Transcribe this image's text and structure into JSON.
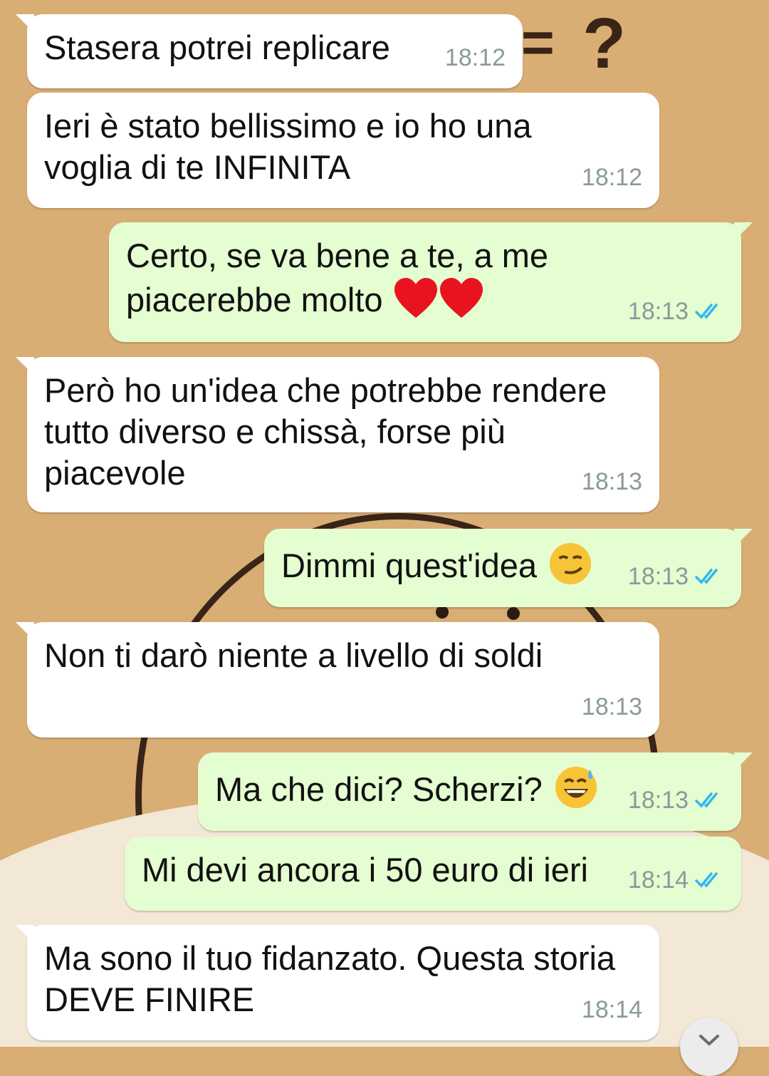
{
  "messages": [
    {
      "direction": "incoming",
      "text": "Stasera potrei replicare",
      "time": "18:12"
    },
    {
      "direction": "incoming",
      "text": "Ieri è stato bellissimo e io ho una\nvoglia di te INFINITA",
      "time": "18:12"
    },
    {
      "direction": "outgoing",
      "text": "Certo, se va bene a te, a me\npiacerebbe molto",
      "emoji": "red-heart-icon x2",
      "time": "18:13",
      "status": "read"
    },
    {
      "direction": "incoming",
      "text": "Però ho un'idea che potrebbe rendere\ntutto diverso e chissà, forse più\npiacevole",
      "time": "18:13"
    },
    {
      "direction": "outgoing",
      "text": "Dimmi quest'idea",
      "emoji": "smirking-face-icon",
      "time": "18:13",
      "status": "read"
    },
    {
      "direction": "incoming",
      "text": "Non ti darò niente a livello di soldi",
      "time": "18:13"
    },
    {
      "direction": "outgoing",
      "text": "Ma che dici? Scherzi?",
      "emoji": "grinning-sweat-face-icon",
      "time": "18:13",
      "status": "read"
    },
    {
      "direction": "outgoing",
      "text": "Mi devi ancora i 50 euro di ieri",
      "time": "18:14",
      "status": "read"
    },
    {
      "direction": "incoming",
      "text": "Ma sono il tuo fidanzato. Questa storia\nDEVE FINIRE",
      "time": "18:14"
    }
  ],
  "colors": {
    "incoming_bubble": "#ffffff",
    "outgoing_bubble": "#e4fdd1",
    "read_ticks": "#34b7f1",
    "timestamp": "#8a9a9a",
    "wallpaper": "#d9ae74"
  },
  "icons": {
    "read_receipt": "double-check-icon",
    "scroll_down": "chevron-down-icon"
  }
}
